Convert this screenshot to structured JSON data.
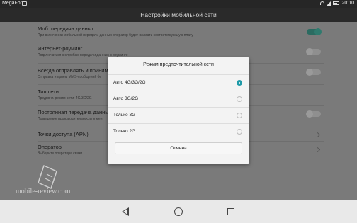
{
  "status_bar": {
    "carrier": "MegaFon",
    "time": "20:10"
  },
  "action_bar": {
    "title": "Настройки мобильной сети"
  },
  "settings": [
    {
      "title": "Моб. передача данных",
      "subtitle": "При включении мобильной передачи данных оператор будет взимать соответствующую плату",
      "control": "toggle",
      "on": true
    },
    {
      "title": "Интернет-роуминг",
      "subtitle": "Подключаться к службам передачи данных в роуминге",
      "control": "toggle",
      "on": false
    },
    {
      "title": "Всегда отправлять и приним",
      "subtitle": "Отправка и прием MMS-сообщений бе",
      "control": "toggle",
      "on": false
    },
    {
      "title": "Тип сети",
      "subtitle": "Предпочт. режим сети: 4G/3G/2G",
      "control": "none"
    },
    {
      "title": "Постоянная передача данны",
      "subtitle": "Повышение производительности и мен",
      "control": "toggle",
      "on": false
    },
    {
      "title": "Точки доступа (APN)",
      "subtitle": "",
      "control": "chevron"
    },
    {
      "title": "Оператор",
      "subtitle": "Выберите оператора связи",
      "control": "chevron"
    }
  ],
  "dialog": {
    "title": "Режим предпочтительной сети",
    "options": [
      {
        "label": "Авто 4G/3G/2G",
        "selected": true
      },
      {
        "label": "Авто 3G/2G",
        "selected": false
      },
      {
        "label": "Только 3G",
        "selected": false
      },
      {
        "label": "Только 2G",
        "selected": false
      }
    ],
    "cancel_label": "Отмена"
  },
  "watermark": {
    "text": "mobile-review.com"
  },
  "colors": {
    "accent": "#1f9aa8",
    "toggle_on": "#2f7a6e"
  }
}
